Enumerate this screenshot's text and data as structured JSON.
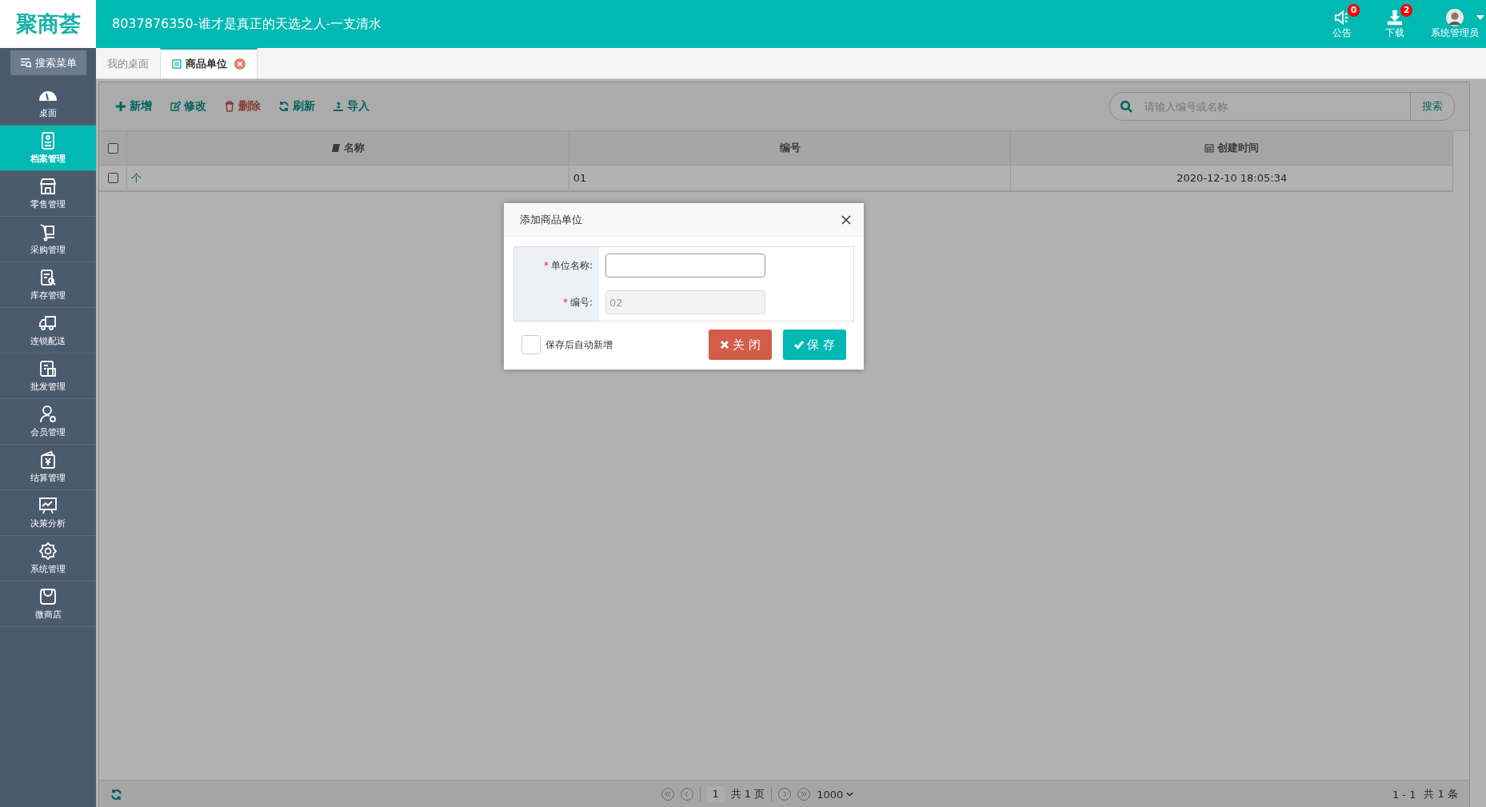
{
  "header": {
    "logo": "聚商荟",
    "title": "8037876350-谁才是真正的天选之人-一支清水",
    "actions": [
      {
        "kind": "notice",
        "label": "公告",
        "badge": "0"
      },
      {
        "kind": "download",
        "label": "下载",
        "badge": "2"
      }
    ],
    "user": {
      "name": "系统管理员"
    }
  },
  "sidebar": {
    "search_label": "搜索菜单",
    "items": [
      {
        "kind": "dashboard",
        "label": "桌面",
        "selected": false
      },
      {
        "kind": "archive",
        "label": "档案管理",
        "selected": true
      },
      {
        "kind": "store",
        "label": "零售管理",
        "selected": false
      },
      {
        "kind": "cart",
        "label": "采购管理",
        "selected": false
      },
      {
        "kind": "stock",
        "label": "库存管理",
        "selected": false
      },
      {
        "kind": "truck",
        "label": "连锁配送",
        "selected": false
      },
      {
        "kind": "wholesale",
        "label": "批发管理",
        "selected": false
      },
      {
        "kind": "member",
        "label": "会员管理",
        "selected": false
      },
      {
        "kind": "wallet",
        "label": "结算管理",
        "selected": false
      },
      {
        "kind": "chart",
        "label": "决策分析",
        "selected": false
      },
      {
        "kind": "gear",
        "label": "系统管理",
        "selected": false
      },
      {
        "kind": "bag",
        "label": "微商店",
        "selected": false
      }
    ]
  },
  "tabs": [
    {
      "label": "我的桌面",
      "selected": false,
      "closable": false
    },
    {
      "label": "商品单位",
      "selected": true,
      "closable": true
    }
  ],
  "toolbar": [
    {
      "kind": "add",
      "label": "新增"
    },
    {
      "kind": "edit",
      "label": "修改"
    },
    {
      "kind": "delete",
      "label": "删除"
    },
    {
      "kind": "refresh",
      "label": "刷新"
    },
    {
      "kind": "import",
      "label": "导入"
    }
  ],
  "search": {
    "placeholder": "请输入编号或名称",
    "button": "搜索"
  },
  "table": {
    "all_checked": false,
    "columns": [
      {
        "kind": "book",
        "label": "名称"
      },
      {
        "kind": "none",
        "label": "编号"
      },
      {
        "kind": "calendar",
        "label": "创建时间"
      }
    ],
    "rows": [
      {
        "checked": false,
        "cells": [
          "个",
          "01",
          "2020-12-10 18:05:34"
        ]
      }
    ]
  },
  "pager": {
    "page": "1",
    "pages": "共 1 页",
    "size": "1000",
    "range": "1 - 1",
    "total": "共 1 条"
  },
  "dialog": {
    "title": "添加商品单位",
    "fields": [
      {
        "label": "单位名称:",
        "required_mark": "*",
        "disabled": false
      },
      {
        "label": "编号:",
        "required_mark": "*",
        "value": "02",
        "disabled": true
      }
    ],
    "auto_add": {
      "label": "保存后自动新增",
      "checked": false
    },
    "buttons": [
      {
        "kind": "close",
        "label": "关 闭"
      },
      {
        "kind": "save",
        "label": "保 存"
      }
    ]
  }
}
